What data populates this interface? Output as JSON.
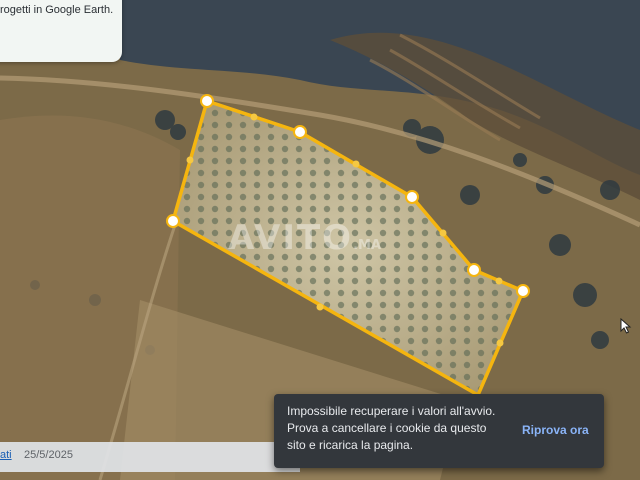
{
  "info_card": {
    "text": "rogetti in Google Earth."
  },
  "polygon": {
    "stroke_color": "#f5b50f",
    "vertex_color": "#ffffff"
  },
  "watermark": {
    "text": "AVITO",
    "suffix": ".MA"
  },
  "footer": {
    "credit_text": "ati",
    "date": "25/5/2025"
  },
  "toast": {
    "message": "Impossibile recuperare i valori all'avvio.\nProva a cancellare i cookie da questo\nsito e ricarica la pagina.",
    "action_label": "Riprova ora",
    "background_color": "#33373c",
    "action_color": "#8ab4f8"
  }
}
